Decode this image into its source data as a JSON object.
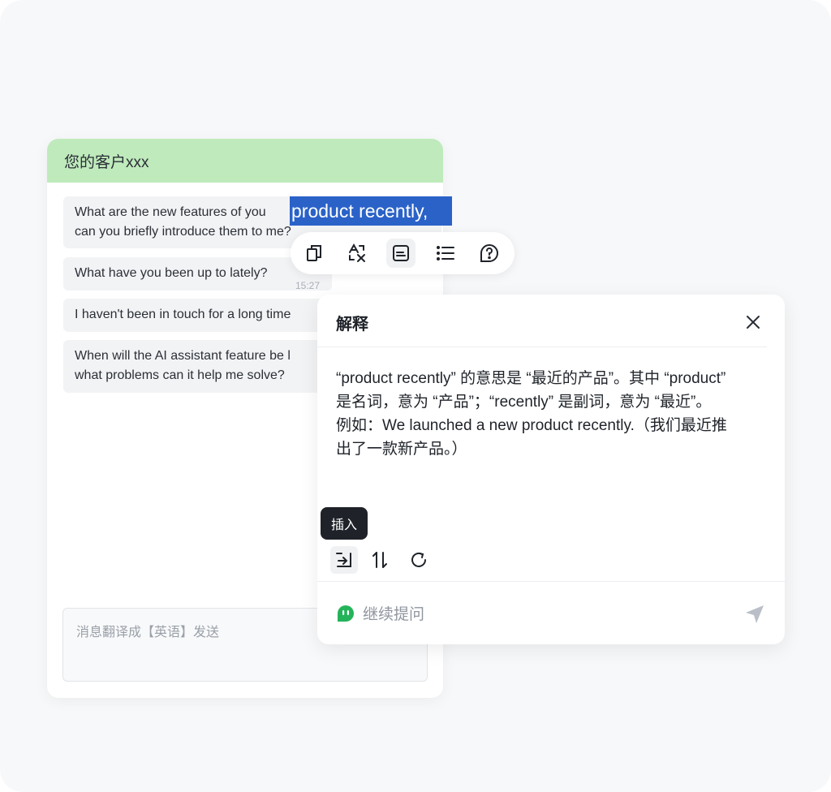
{
  "chat": {
    "title": "您的客户xxx",
    "messages": [
      {
        "line1": "What are the new features of you",
        "line2": "can you briefly introduce them to me?"
      },
      {
        "text": "What have you been up to lately?",
        "time": "15:27"
      },
      {
        "text": "I haven't been in touch for a long time"
      },
      {
        "line1": "When will the AI assistant feature be l",
        "line2": "what problems can it help me solve?"
      }
    ],
    "selection": "product recently,",
    "input_placeholder": "消息翻译成【英语】发送"
  },
  "toolbar": {
    "icons": [
      "copy-icon",
      "translate-icon",
      "explain-icon",
      "list-icon",
      "question-icon"
    ],
    "active": "explain-icon"
  },
  "panel": {
    "title": "解释",
    "body_lines": [
      "“product recently” 的意思是 “最近的产品”。其中 “product”",
      "是名词，意为 “产品”；“recently” 是副词，意为 “最近”。",
      "例如：We launched a new product recently.（我们最近推",
      "出了一款新产品。）"
    ],
    "tooltip": "插入",
    "actions": [
      "insert-icon",
      "swap-icon",
      "refresh-icon"
    ],
    "follow_up_placeholder": "继续提问",
    "accent_color": "#24b35a"
  }
}
